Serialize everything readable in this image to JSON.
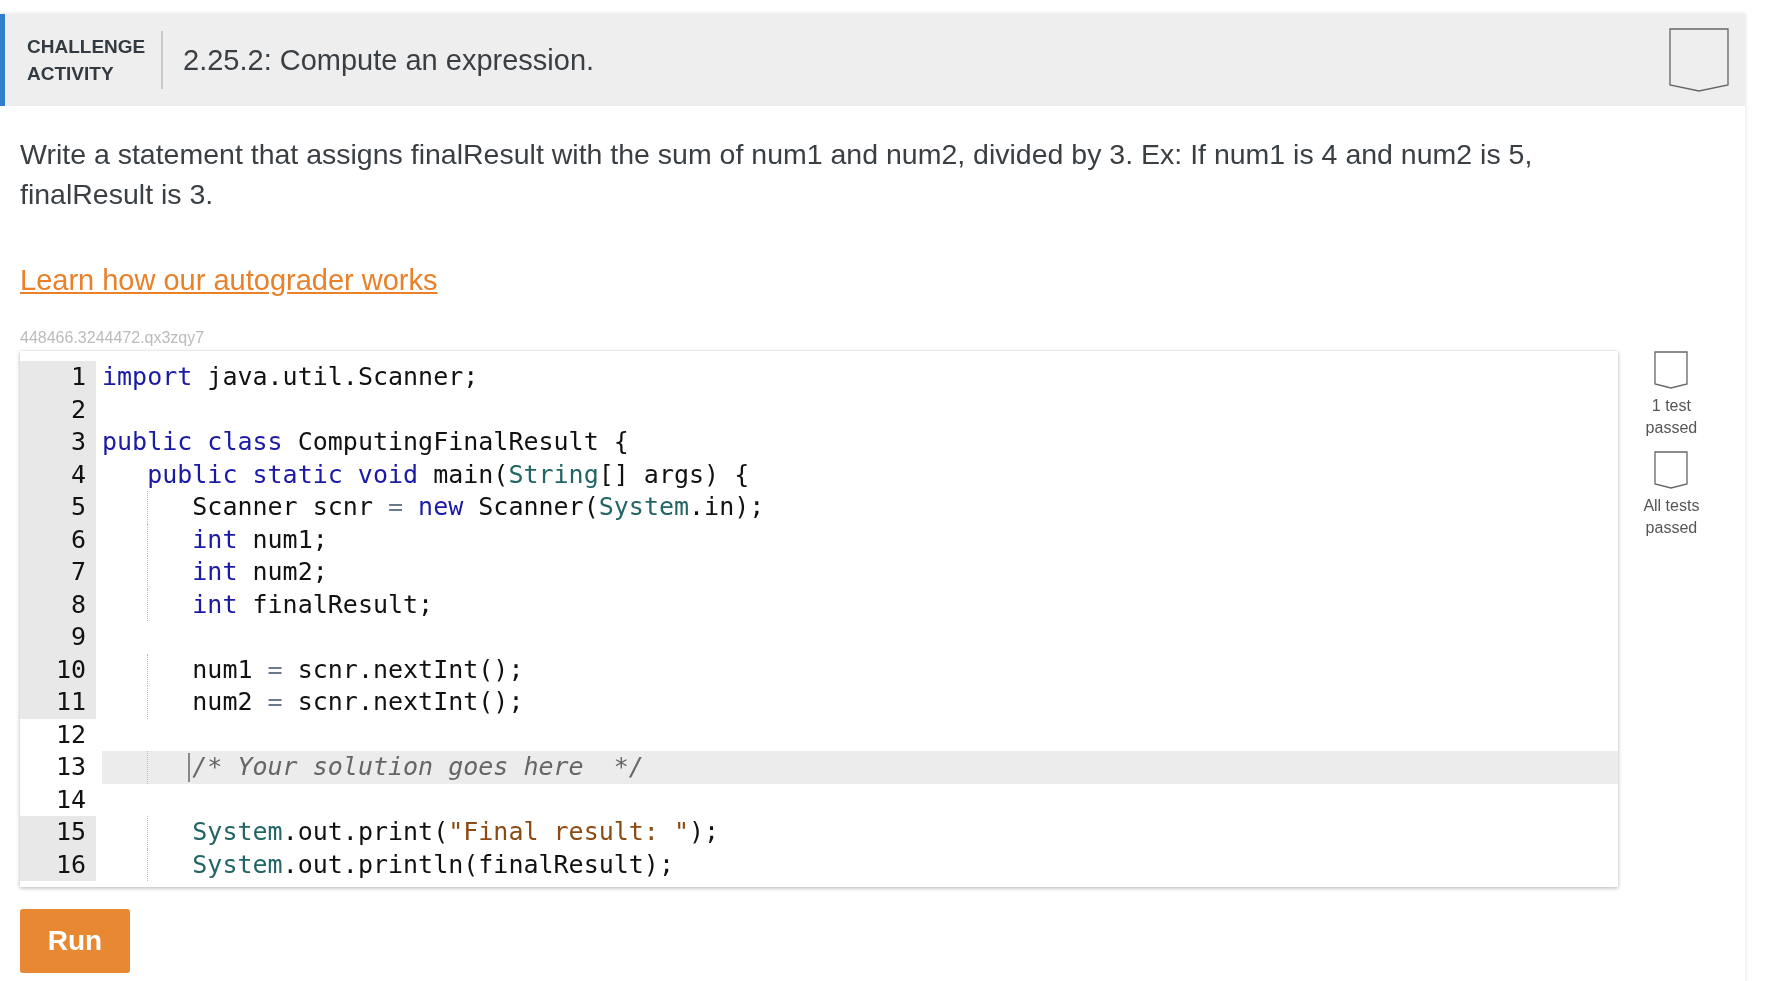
{
  "header": {
    "label": "CHALLENGE ACTIVITY",
    "title": "2.25.2: Compute an expression.",
    "completed": false
  },
  "instructions": "Write a statement that assigns finalResult with the sum of num1 and num2, divided by 3. Ex: If num1 is 4 and num2 is 5, finalResult is 3.",
  "help_link": "Learn how our autograder works",
  "problem_id": "448466.3244472.qx3zqy7",
  "code_lines": [
    {
      "number": "1",
      "editable": false,
      "selected": false,
      "tokens": [
        {
          "kind": "keyword",
          "text": "import"
        },
        {
          "kind": "plain",
          "text": " java.util.Scanner;"
        }
      ]
    },
    {
      "number": "2",
      "editable": false,
      "selected": false
    },
    {
      "number": "3",
      "editable": false,
      "selected": false,
      "tokens": [
        {
          "kind": "keyword",
          "text": "public class"
        },
        {
          "kind": "plain",
          "text": " ComputingFinalResult {"
        }
      ]
    },
    {
      "number": "4",
      "editable": false,
      "selected": false,
      "tokens": [
        {
          "kind": "keyword",
          "text": "   public static void"
        },
        {
          "kind": "plain",
          "text": " main("
        },
        {
          "kind": "type",
          "text": "String"
        },
        {
          "kind": "plain",
          "text": "[] args) {"
        }
      ]
    },
    {
      "number": "5",
      "editable": false,
      "selected": false,
      "tokens": [
        {
          "kind": "plain",
          "text": "      Scanner scnr "
        },
        {
          "kind": "operator",
          "text": "="
        },
        {
          "kind": "keyword",
          "text": " new"
        },
        {
          "kind": "plain",
          "text": " Scanner("
        },
        {
          "kind": "type",
          "text": "System"
        },
        {
          "kind": "plain",
          "text": ".in);"
        }
      ]
    },
    {
      "number": "6",
      "editable": false,
      "selected": false,
      "tokens": [
        {
          "kind": "keyword",
          "text": "      int"
        },
        {
          "kind": "plain",
          "text": " num1;"
        }
      ]
    },
    {
      "number": "7",
      "editable": false,
      "selected": false,
      "tokens": [
        {
          "kind": "keyword",
          "text": "      int"
        },
        {
          "kind": "plain",
          "text": " num2;"
        }
      ]
    },
    {
      "number": "8",
      "editable": false,
      "selected": false,
      "tokens": [
        {
          "kind": "keyword",
          "text": "      int"
        },
        {
          "kind": "plain",
          "text": " finalResult;"
        }
      ]
    },
    {
      "number": "9",
      "editable": false,
      "selected": false
    },
    {
      "number": "10",
      "editable": false,
      "selected": false,
      "tokens": [
        {
          "kind": "plain",
          "text": "      num1 "
        },
        {
          "kind": "operator",
          "text": "="
        },
        {
          "kind": "plain",
          "text": " scnr.nextInt();"
        }
      ]
    },
    {
      "number": "11",
      "editable": false,
      "selected": false,
      "tokens": [
        {
          "kind": "plain",
          "text": "      num2 "
        },
        {
          "kind": "operator",
          "text": "="
        },
        {
          "kind": "plain",
          "text": " scnr.nextInt();"
        }
      ]
    },
    {
      "number": "12",
      "editable": true,
      "selected": false
    },
    {
      "number": "13",
      "editable": true,
      "selected": true,
      "tokens": [
        {
          "kind": "comment",
          "text": "      /* Your solution goes here  */"
        }
      ]
    },
    {
      "number": "14",
      "editable": true,
      "selected": false
    },
    {
      "number": "15",
      "editable": false,
      "selected": false,
      "tokens": [
        {
          "kind": "type",
          "text": "      System"
        },
        {
          "kind": "plain",
          "text": ".out.print("
        },
        {
          "kind": "string",
          "text": "\"Final result: \""
        },
        {
          "kind": "plain",
          "text": ");"
        }
      ]
    },
    {
      "number": "16",
      "editable": false,
      "selected": false,
      "tokens": [
        {
          "kind": "type",
          "text": "      System"
        },
        {
          "kind": "plain",
          "text": ".out.println(finalResult);"
        }
      ]
    }
  ],
  "progress": [
    {
      "label": "1 test passed",
      "completed": false
    },
    {
      "label": "All tests passed",
      "completed": false
    }
  ],
  "run_button": "Run"
}
